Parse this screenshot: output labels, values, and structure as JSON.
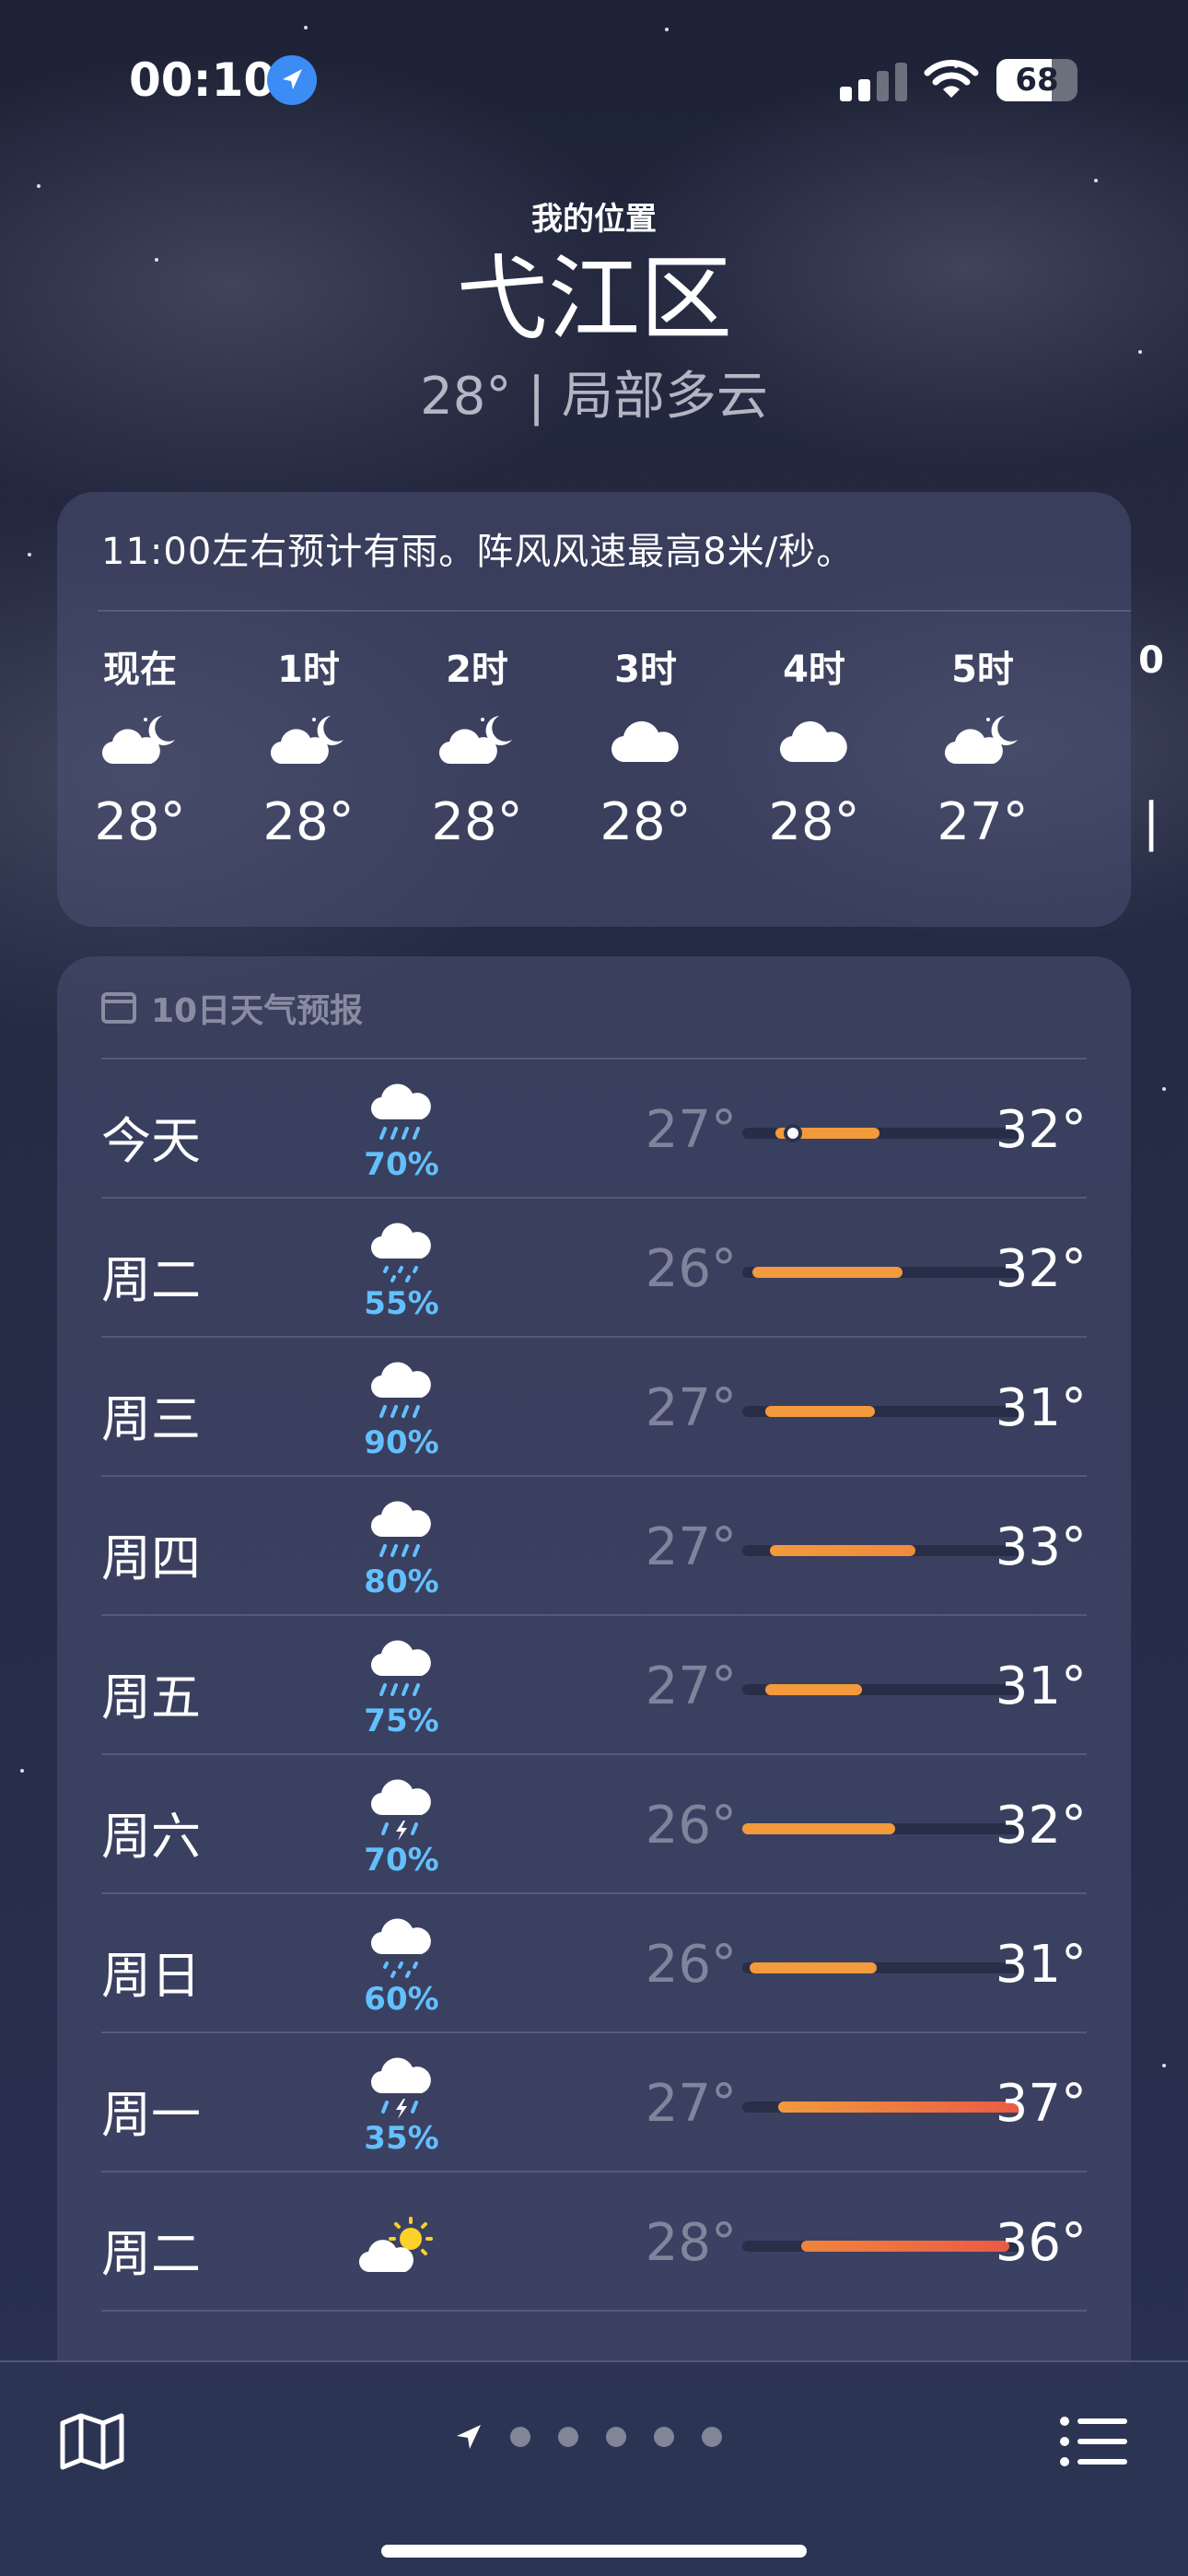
{
  "status_bar": {
    "time": "00:10",
    "battery": "68",
    "battery_level": 0.68
  },
  "header": {
    "my_location": "我的位置",
    "city": "弋江区",
    "summary": "28° | 局部多云"
  },
  "hourly": {
    "note": "11:00左右预计有雨。阵风风速最高8米/秒。",
    "items": [
      {
        "label": "现在",
        "icon": "partly-cloudy-night-icon",
        "temp": "28°"
      },
      {
        "label": "1时",
        "icon": "partly-cloudy-night-icon",
        "temp": "28°"
      },
      {
        "label": "2时",
        "icon": "partly-cloudy-night-icon",
        "temp": "28°"
      },
      {
        "label": "3时",
        "icon": "cloud-icon",
        "temp": "28°"
      },
      {
        "label": "4时",
        "icon": "cloud-icon",
        "temp": "28°"
      },
      {
        "label": "5时",
        "icon": "partly-cloudy-night-icon",
        "temp": "27°"
      },
      {
        "label": "0",
        "icon": "",
        "temp": "|"
      }
    ]
  },
  "daily": {
    "header": "10日天气预报",
    "range_min": 26,
    "range_max": 37,
    "current_temp": 28,
    "days": [
      {
        "name": "今天",
        "icon": "cloud-rain-icon",
        "pct": "70%",
        "low": "27°",
        "high": "32°",
        "low_v": 27.3,
        "high_v": 31.4,
        "color": [
          "#f29a3c",
          "#f29a3c"
        ],
        "now": true
      },
      {
        "name": "周二",
        "icon": "cloud-drizzle-icon",
        "pct": "55%",
        "low": "26°",
        "high": "32°",
        "low_v": 26.4,
        "high_v": 32.3,
        "color": [
          "#f29a3c",
          "#f29a3c"
        ]
      },
      {
        "name": "周三",
        "icon": "cloud-rain-icon",
        "pct": "90%",
        "low": "27°",
        "high": "31°",
        "low_v": 26.9,
        "high_v": 31.2,
        "color": [
          "#f29a3c",
          "#f29a3c"
        ]
      },
      {
        "name": "周四",
        "icon": "cloud-rain-icon",
        "pct": "80%",
        "low": "27°",
        "high": "33°",
        "low_v": 27.1,
        "high_v": 32.8,
        "color": [
          "#f29a3c",
          "#f08a3c"
        ]
      },
      {
        "name": "周五",
        "icon": "cloud-rain-icon",
        "pct": "75%",
        "low": "27°",
        "high": "31°",
        "low_v": 26.9,
        "high_v": 30.7,
        "color": [
          "#f29a3c",
          "#f29a3c"
        ]
      },
      {
        "name": "周六",
        "icon": "cloud-bolt-rain-icon",
        "pct": "70%",
        "low": "26°",
        "high": "32°",
        "low_v": 26.0,
        "high_v": 32.0,
        "color": [
          "#f29a3c",
          "#f29a3c"
        ]
      },
      {
        "name": "周日",
        "icon": "cloud-drizzle-icon",
        "pct": "60%",
        "low": "26°",
        "high": "31°",
        "low_v": 26.3,
        "high_v": 31.3,
        "color": [
          "#f29a3c",
          "#f29a3c"
        ]
      },
      {
        "name": "周一",
        "icon": "cloud-bolt-rain-icon",
        "pct": "35%",
        "low": "27°",
        "high": "37°",
        "low_v": 27.4,
        "high_v": 37.0,
        "color": [
          "#f29a3c",
          "#ea5a45"
        ]
      },
      {
        "name": "周二",
        "icon": "partly-sunny-icon",
        "pct": "",
        "low": "28°",
        "high": "36°",
        "low_v": 28.3,
        "high_v": 36.5,
        "color": [
          "#f0843c",
          "#ea5a45"
        ]
      }
    ]
  },
  "bottom_bar": {
    "pages": 5
  }
}
